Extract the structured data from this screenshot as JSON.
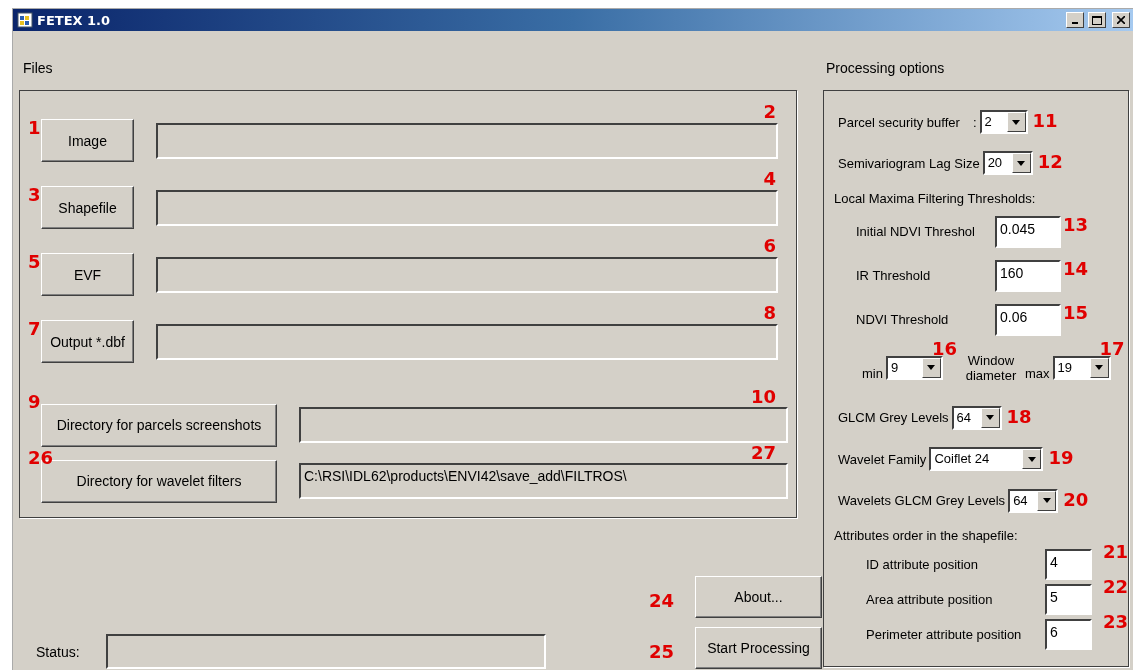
{
  "window": {
    "title": "FETEX 1.0"
  },
  "files": {
    "label": "Files",
    "rows": [
      {
        "kind": "short",
        "button": "Image",
        "button_marker": "1",
        "field_marker": "2"
      },
      {
        "kind": "short",
        "button": "Shapefile",
        "button_marker": "3",
        "field_marker": "4"
      },
      {
        "kind": "short",
        "button": "EVF",
        "button_marker": "5",
        "field_marker": "6"
      },
      {
        "kind": "short",
        "button": "Output *.dbf",
        "button_marker": "7",
        "field_marker": "8"
      },
      {
        "kind": "wide",
        "button": "Directory for parcels screenshots",
        "button_marker": "9",
        "field_marker": "10"
      },
      {
        "kind": "wide",
        "button": "Directory for wavelet filters",
        "button_marker": "26",
        "field_marker": "27",
        "value": "C:\\RSI\\IDL62\\products\\ENVI42\\save_add\\FILTROS\\"
      }
    ]
  },
  "processing": {
    "label": "Processing options",
    "items": [
      {
        "kind": "dropdown",
        "label": "Parcel security buffer",
        "colon": ":",
        "value": "2",
        "marker": "11"
      },
      {
        "kind": "dropdown",
        "label": "Semivariogram Lag Size",
        "value": "20",
        "marker": "12"
      },
      {
        "kind": "group",
        "label": "Local Maxima Filtering Thresholds:",
        "children": [
          {
            "kind": "field",
            "label": "Initial NDVI Threshol",
            "value": "0.045",
            "marker": "13"
          },
          {
            "kind": "field",
            "label": "IR Threshold",
            "value": "160",
            "marker": "14"
          },
          {
            "kind": "field",
            "label": "NDVI Threshold",
            "value": "0.06",
            "marker": "15"
          },
          {
            "kind": "window",
            "min_label": "min",
            "min_value": "9",
            "min_marker": "16",
            "label": "Window diameter",
            "max_label": "max",
            "max_value": "19",
            "max_marker": "17"
          }
        ]
      },
      {
        "kind": "dropdown",
        "label": "GLCM Grey Levels",
        "value": "64",
        "marker": "18"
      },
      {
        "kind": "dropdown",
        "label": "Wavelet Family",
        "value": "Coiflet 24",
        "marker": "19"
      },
      {
        "kind": "dropdown",
        "label": "Wavelets GLCM Grey Levels",
        "value": "64",
        "marker": "20"
      },
      {
        "kind": "group",
        "label": "Attributes order in the shapefile:",
        "children": [
          {
            "kind": "position",
            "label": "ID attribute position",
            "value": "4",
            "marker": "21"
          },
          {
            "kind": "position",
            "label": "Area attribute position",
            "value": "5",
            "marker": "22"
          },
          {
            "kind": "position",
            "label": "Perimeter attribute position",
            "value": "6",
            "marker": "23"
          }
        ]
      }
    ]
  },
  "status": {
    "label": "Status:"
  },
  "buttons": [
    {
      "label": "About...",
      "marker": "24"
    },
    {
      "label": "Start Processing",
      "marker": "25"
    }
  ]
}
